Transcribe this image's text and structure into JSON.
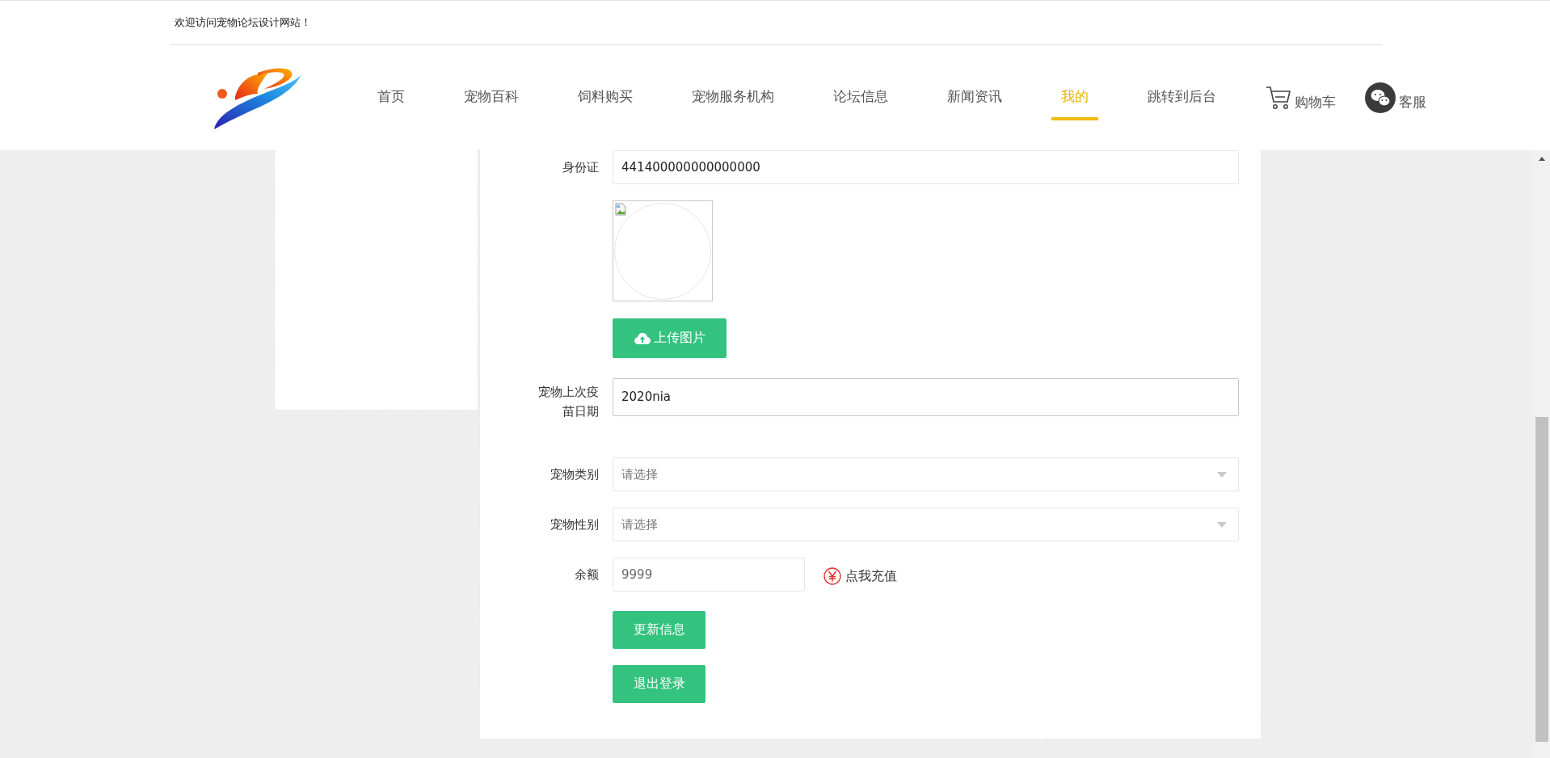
{
  "top_bar": {
    "welcome": "欢迎访问宠物论坛设计网站！"
  },
  "nav": [
    {
      "label": "首页",
      "selected": false
    },
    {
      "label": "宠物百科",
      "selected": false
    },
    {
      "label": "饲料购买",
      "selected": false
    },
    {
      "label": "宠物服务机构",
      "selected": false
    },
    {
      "label": "论坛信息",
      "selected": false
    },
    {
      "label": "新闻资讯",
      "selected": false
    },
    {
      "label": "我的",
      "selected": true
    },
    {
      "label": "跳转到后台",
      "selected": false
    }
  ],
  "cart": {
    "label": "购物车"
  },
  "service": {
    "label": "客服"
  },
  "form": {
    "id_card": {
      "label": "身份证",
      "value": "441400000000000000"
    },
    "upload_button": "上传图片",
    "vaccine_date": {
      "label": "宠物上次疫苗日期",
      "value": "2020nia"
    },
    "selects": [
      {
        "label": "宠物类别",
        "placeholder": "请选择"
      },
      {
        "label": "宠物性别",
        "placeholder": "请选择"
      }
    ],
    "balance": {
      "label": "余额",
      "value": "9999",
      "recharge": "点我充值"
    },
    "buttons": [
      "更新信息",
      "退出登录"
    ]
  }
}
